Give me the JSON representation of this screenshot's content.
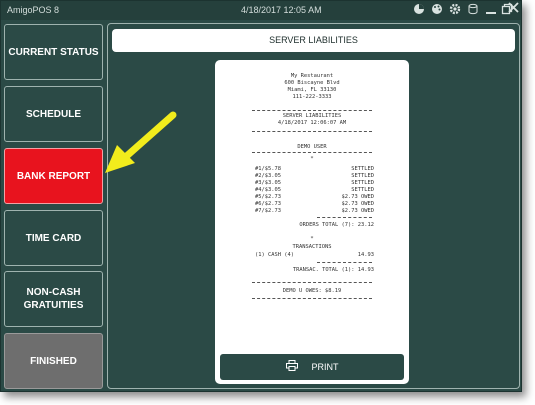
{
  "window": {
    "app_title": "AmigoPOS 8",
    "datetime": "4/18/2017 12:05 AM",
    "icons": [
      "pie-chart-icon",
      "palette-icon",
      "gear-icon",
      "database-icon",
      "minimize-icon",
      "restore-icon",
      "close-icon"
    ]
  },
  "sidebar": {
    "items": [
      {
        "label": "CURRENT STATUS"
      },
      {
        "label": "SCHEDULE"
      },
      {
        "label": "BANK REPORT"
      },
      {
        "label": "TIME CARD"
      },
      {
        "label": "NON-CASH GRATUITIES"
      },
      {
        "label": "FINISHED"
      }
    ],
    "active_color": "#e8131e"
  },
  "main": {
    "header": "SERVER LIABILITIES",
    "print_label": "PRINT"
  },
  "receipt": {
    "restaurant": "My Restaurant",
    "address1": "600 Biscayne Blvd",
    "address2": "Miami, FL 33130",
    "phone": "111-222-3333",
    "report_title": "SERVER LIABILITIES",
    "report_datetime": "4/18/2017 12:06:07 AM",
    "server_name": "DEMO USER",
    "orders_marker": "*",
    "orders": [
      {
        "left": "#1/$5.78",
        "right": "SETTLED"
      },
      {
        "left": "#2/$3.05",
        "right": "SETTLED"
      },
      {
        "left": "#3/$3.05",
        "right": "SETTLED"
      },
      {
        "left": "#4/$3.05",
        "right": "SETTLED"
      },
      {
        "left": "#5/$2.73",
        "right": "$2.73 OWED"
      },
      {
        "left": "#6/$2.73",
        "right": "$2.73 OWED"
      },
      {
        "left": "#7/$2.73",
        "right": "$2.73 OWED"
      }
    ],
    "orders_total": "ORDERS TOTAL (7):  23.12",
    "trans_marker": "*",
    "transactions_title": "TRANSACTIONS",
    "transaction_left": "(1) CASH (4)",
    "transaction_right": "14.93",
    "trans_total": "TRANSAC. TOTAL (1):  14.93",
    "owes": "DEMO U OWES:  $8.19"
  },
  "colors": {
    "background": "#2b4a46",
    "active": "#e8131e",
    "finished": "#6e6e6e",
    "arrow": "#f2ec1c"
  }
}
